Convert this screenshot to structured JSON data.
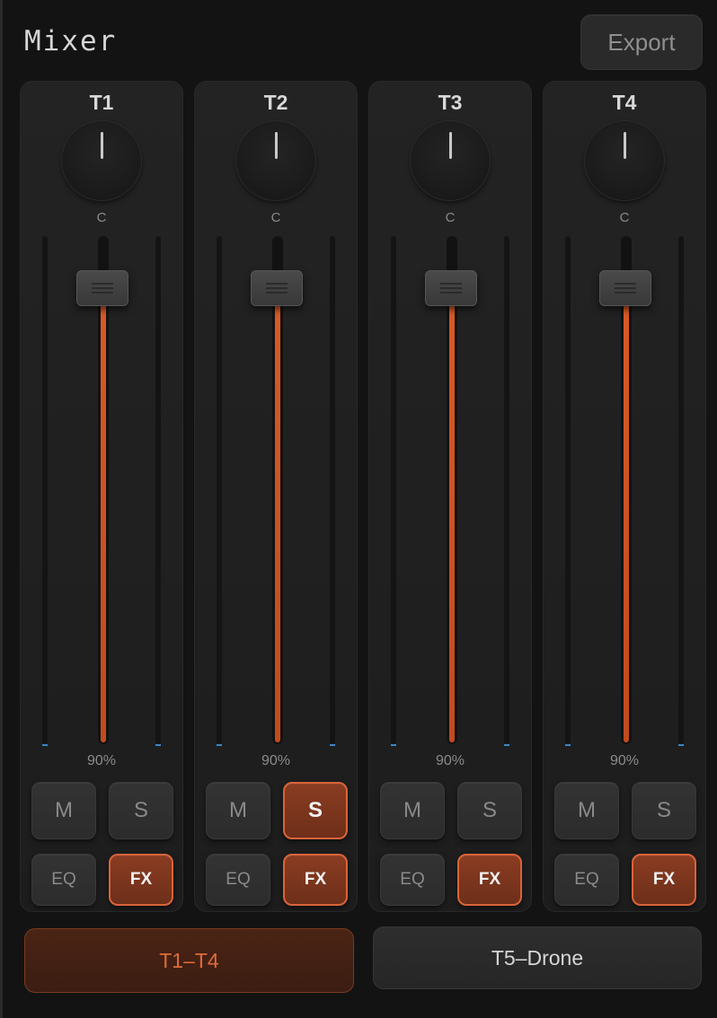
{
  "app": {
    "title": "Mixer",
    "export_label": "Export"
  },
  "colors": {
    "background": "#131313",
    "accent": "#d85a26",
    "meter_peak": "#3a86c8"
  },
  "tracks": [
    {
      "name": "T1",
      "pan": "C",
      "volume_label": "90%",
      "volume": 0.9,
      "mute": {
        "label": "M",
        "active": false
      },
      "solo": {
        "label": "S",
        "active": false
      },
      "eq": {
        "label": "EQ",
        "active": false
      },
      "fx": {
        "label": "FX",
        "active": true
      }
    },
    {
      "name": "T2",
      "pan": "C",
      "volume_label": "90%",
      "volume": 0.9,
      "mute": {
        "label": "M",
        "active": false
      },
      "solo": {
        "label": "S",
        "active": true
      },
      "eq": {
        "label": "EQ",
        "active": false
      },
      "fx": {
        "label": "FX",
        "active": true
      }
    },
    {
      "name": "T3",
      "pan": "C",
      "volume_label": "90%",
      "volume": 0.9,
      "mute": {
        "label": "M",
        "active": false
      },
      "solo": {
        "label": "S",
        "active": false
      },
      "eq": {
        "label": "EQ",
        "active": false
      },
      "fx": {
        "label": "FX",
        "active": true
      }
    },
    {
      "name": "T4",
      "pan": "C",
      "volume_label": "90%",
      "volume": 0.9,
      "mute": {
        "label": "M",
        "active": false
      },
      "solo": {
        "label": "S",
        "active": false
      },
      "eq": {
        "label": "EQ",
        "active": false
      },
      "fx": {
        "label": "FX",
        "active": true
      }
    }
  ],
  "banks": [
    {
      "label": "T1–T4",
      "active": true
    },
    {
      "label": "T5–Drone",
      "active": false
    }
  ]
}
